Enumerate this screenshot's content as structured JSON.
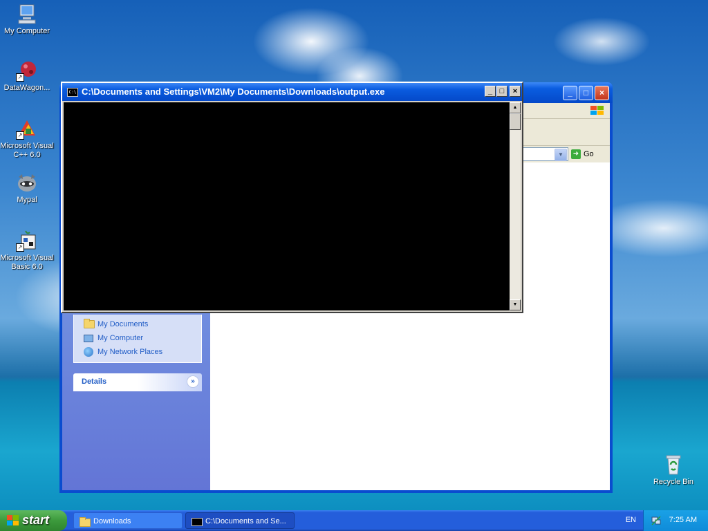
{
  "desktop": {
    "icons": [
      {
        "label": "My Computer"
      },
      {
        "label": "DataWagon..."
      },
      {
        "label": "Microsoft Visual C++ 6.0"
      },
      {
        "label": "Mypal"
      },
      {
        "label": "Microsoft Visual Basic 6.0"
      },
      {
        "label": "Recycle Bin"
      }
    ]
  },
  "console": {
    "title": "C:\\Documents and Settings\\VM2\\My Documents\\Downloads\\output.exe",
    "icon_text": "C:\\",
    "minimize": "_",
    "maximize": "□",
    "close": "×"
  },
  "explorer": {
    "go_label": "Go",
    "other_places": [
      {
        "label": "My Documents"
      },
      {
        "label": "My Computer"
      },
      {
        "label": "My Network Places"
      }
    ],
    "details_label": "Details"
  },
  "taskbar": {
    "start_label": "start",
    "tasks": [
      {
        "label": "Downloads"
      },
      {
        "label": "C:\\Documents and Se..."
      }
    ],
    "language": "EN",
    "clock": "7:25 AM"
  },
  "colors": {
    "xp_blue": "#0a5ce0",
    "start_green": "#3c9a3c",
    "console_bg": "#000000",
    "task_link": "#215dc6"
  }
}
